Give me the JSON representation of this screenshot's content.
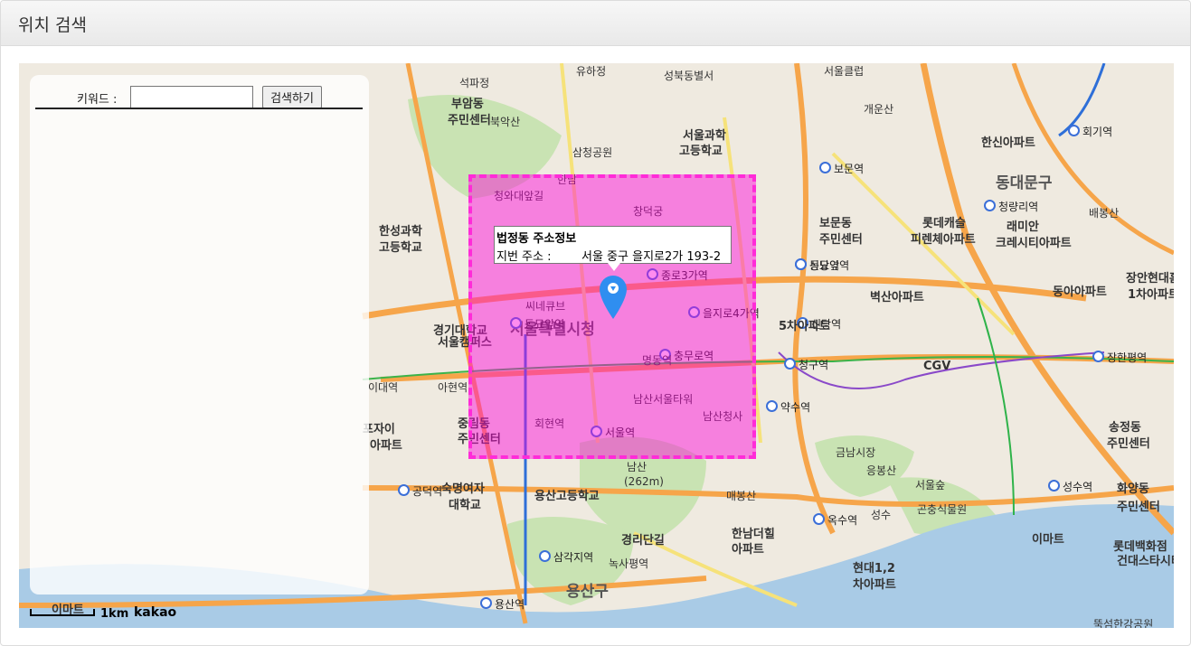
{
  "panel": {
    "title": "위치 검색"
  },
  "search": {
    "keyword_label": "키워드 :",
    "input_value": "",
    "button_label": "검색하기"
  },
  "info_window": {
    "title": "법정동 주소정보",
    "address_label": "지번 주소 :",
    "address_value": "서울 중구 을지로2가 193-2"
  },
  "map": {
    "scale_label": "1km",
    "provider_logo": "kakao",
    "highlight_color": "#ff2bd8",
    "marker_color": "#2f8ef0",
    "labels": [
      {
        "text": "서울특별시청",
        "kind": "city"
      },
      {
        "text": "석파정",
        "kind": "normal"
      },
      {
        "text": "부암동",
        "kind": "big"
      },
      {
        "text": "주민센터",
        "kind": "big"
      },
      {
        "text": "북악산",
        "kind": "normal"
      },
      {
        "text": "삼청공원",
        "kind": "normal"
      },
      {
        "text": "서울과학",
        "kind": "big"
      },
      {
        "text": "고등학교",
        "kind": "big"
      },
      {
        "text": "성북동별서",
        "kind": "normal"
      },
      {
        "text": "유하정",
        "kind": "normal"
      },
      {
        "text": "개운산",
        "kind": "normal"
      },
      {
        "text": "한신아파트",
        "kind": "big"
      },
      {
        "text": "회기역",
        "kind": "station"
      },
      {
        "text": "동대문구",
        "kind": "city"
      },
      {
        "text": "청량리역",
        "kind": "station"
      },
      {
        "text": "배봉산",
        "kind": "normal"
      },
      {
        "text": "래미안",
        "kind": "big"
      },
      {
        "text": "크레시티아파트",
        "kind": "big"
      },
      {
        "text": "보문역",
        "kind": "station"
      },
      {
        "text": "보문동",
        "kind": "big"
      },
      {
        "text": "주민센터",
        "kind": "big"
      },
      {
        "text": "롯데캐슬",
        "kind": "big"
      },
      {
        "text": "피렌체아파트",
        "kind": "big"
      },
      {
        "text": "동묘앞역",
        "kind": "station"
      },
      {
        "text": "벽산아파트",
        "kind": "big"
      },
      {
        "text": "동아아파트",
        "kind": "big"
      },
      {
        "text": "장안현대홈",
        "kind": "big"
      },
      {
        "text": "1차아파트",
        "kind": "big"
      },
      {
        "text": "신당역",
        "kind": "station"
      },
      {
        "text": "청구역",
        "kind": "station"
      },
      {
        "text": "CGV",
        "kind": "big"
      },
      {
        "text": "장한평역",
        "kind": "station"
      },
      {
        "text": "약수역",
        "kind": "station"
      },
      {
        "text": "금남시장",
        "kind": "normal"
      },
      {
        "text": "응봉산",
        "kind": "normal"
      },
      {
        "text": "송정동",
        "kind": "big"
      },
      {
        "text": "주민센터",
        "kind": "big"
      },
      {
        "text": "서울숲",
        "kind": "normal"
      },
      {
        "text": "곤충식물원",
        "kind": "normal"
      },
      {
        "text": "성수역",
        "kind": "station"
      },
      {
        "text": "화양동",
        "kind": "big"
      },
      {
        "text": "주민센터",
        "kind": "big"
      },
      {
        "text": "이마트",
        "kind": "big"
      },
      {
        "text": "롯데백화점",
        "kind": "big"
      },
      {
        "text": "건대스타시티",
        "kind": "big"
      },
      {
        "text": "옥수역",
        "kind": "station"
      },
      {
        "text": "성수",
        "kind": "normal"
      },
      {
        "text": "현대1,2",
        "kind": "big"
      },
      {
        "text": "차아파트",
        "kind": "big"
      },
      {
        "text": "뚝섬한강공원",
        "kind": "normal"
      },
      {
        "text": "한남더힐",
        "kind": "big"
      },
      {
        "text": "아파트",
        "kind": "big"
      },
      {
        "text": "매봉산",
        "kind": "normal"
      },
      {
        "text": "남산",
        "kind": "normal"
      },
      {
        "text": "(262m)",
        "kind": "normal"
      },
      {
        "text": "용산고등학교",
        "kind": "big"
      },
      {
        "text": "경리단길",
        "kind": "big"
      },
      {
        "text": "삼각지역",
        "kind": "station"
      },
      {
        "text": "녹사평역",
        "kind": "normal"
      },
      {
        "text": "용산구",
        "kind": "city"
      },
      {
        "text": "용산역",
        "kind": "station"
      },
      {
        "text": "공덕역",
        "kind": "station"
      },
      {
        "text": "숙명여자",
        "kind": "big"
      },
      {
        "text": "대학교",
        "kind": "big"
      },
      {
        "text": "한남",
        "kind": "normal"
      },
      {
        "text": "포자이",
        "kind": "big"
      },
      {
        "text": "아파트",
        "kind": "big"
      },
      {
        "text": "한성과학",
        "kind": "big"
      },
      {
        "text": "고등학교",
        "kind": "big"
      },
      {
        "text": "이대역",
        "kind": "normal"
      },
      {
        "text": "아현역",
        "kind": "normal"
      },
      {
        "text": "중림동",
        "kind": "big"
      },
      {
        "text": "주민센터",
        "kind": "big"
      },
      {
        "text": "경기대학교",
        "kind": "big"
      },
      {
        "text": "서울캠퍼스",
        "kind": "big"
      },
      {
        "text": "씨네큐브",
        "kind": "normal"
      },
      {
        "text": "창덕궁",
        "kind": "normal"
      },
      {
        "text": "청와대앞길",
        "kind": "normal"
      },
      {
        "text": "종로3가역",
        "kind": "station"
      },
      {
        "text": "을지로4가역",
        "kind": "station"
      },
      {
        "text": "충무로역",
        "kind": "station"
      },
      {
        "text": "명동역",
        "kind": "normal"
      },
      {
        "text": "회현역",
        "kind": "normal"
      },
      {
        "text": "서울역",
        "kind": "station"
      },
      {
        "text": "남산서울타워",
        "kind": "normal"
      },
      {
        "text": "남산청사",
        "kind": "normal"
      },
      {
        "text": "서울클럽",
        "kind": "normal"
      },
      {
        "text": "이마트",
        "kind": "big"
      },
      {
        "text": "5차아파트",
        "kind": "big"
      },
      {
        "text": "신당역",
        "kind": "station"
      },
      {
        "text": "동묘앞역",
        "kind": "station"
      }
    ]
  }
}
